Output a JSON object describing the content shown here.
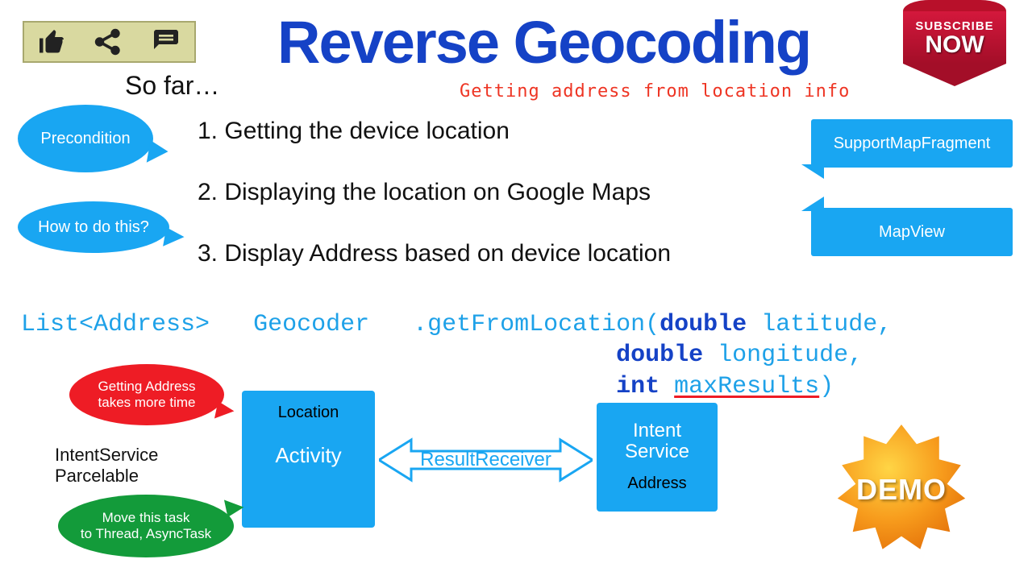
{
  "title": "Reverse Geocoding",
  "subtitle": "Getting address from location info",
  "so_far": "So far…",
  "subscribe": {
    "line1": "SUBSCRIBE",
    "line2": "NOW"
  },
  "bubbles": {
    "precondition": "Precondition",
    "howto": "How to do this?"
  },
  "steps": [
    "1. Getting the device location",
    "2. Displaying the location on Google Maps",
    "3. Display Address based on device location"
  ],
  "right_callouts": {
    "support_map_fragment": "SupportMapFragment",
    "map_view": "MapView"
  },
  "code": {
    "list_address": "List<Address>",
    "geocoder": "Geocoder",
    "method": ".getFromLocation(",
    "param1_type": "double",
    "param1_name": " latitude,",
    "param2_type": "double",
    "param2_name": " longitude,",
    "param3_type": "int",
    "param3_name_underlined": "maxResults",
    "close": ")"
  },
  "diagram": {
    "activity_top": "Location",
    "activity_main": "Activity",
    "arrow_label": "ResultReceiver",
    "intent_main": "Intent\nService",
    "intent_bottom": "Address"
  },
  "notes": {
    "red": "Getting Address\ntakes more time",
    "green": "Move this task\nto Thread, AsyncTask",
    "left_labels": "IntentService\nParcelable"
  },
  "demo": "DEMO",
  "colors": {
    "blue_accent": "#19a6f2",
    "title_blue": "#1542c6",
    "red": "#ee1c25",
    "green": "#139b3a",
    "orange": "#f79b1c"
  }
}
